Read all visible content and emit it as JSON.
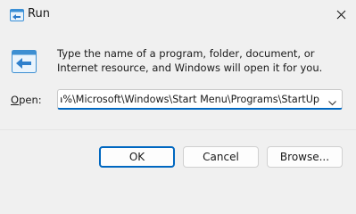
{
  "window": {
    "title": "Run"
  },
  "content": {
    "description": "Type the name of a program, folder, document, or Internet resource, and Windows will open it for you.",
    "open_label_accel": "O",
    "open_label_rest": "pen:",
    "open_value": ":a%\\Microsoft\\Windows\\Start Menu\\Programs\\StartUp"
  },
  "buttons": {
    "ok_label": "OK",
    "cancel_label": "Cancel",
    "browse_label": "Browse..."
  },
  "icons": {
    "app": "run-icon",
    "close": "close-icon",
    "dropdown": "chevron-down-icon"
  },
  "colors": {
    "accent": "#0067c0",
    "background": "#f0f0f0"
  }
}
